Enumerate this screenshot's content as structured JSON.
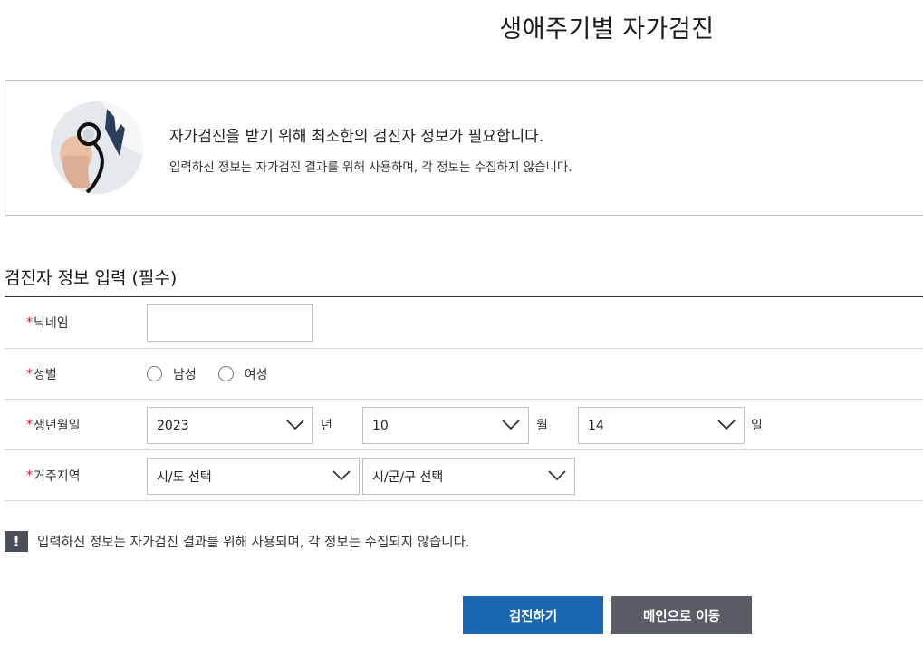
{
  "page": {
    "title": "생애주기별 자가검진"
  },
  "intro": {
    "image_icon": "stethoscope-doctor-photo",
    "main_text": "자가검진을 받기 위해 최소한의 검진자 정보가 필요합니다.",
    "sub_text": "입력하신 정보는 자가검진 결과를 위해 사용하며, 각 정보는 수집하지 않습니다."
  },
  "form": {
    "section_title": "검진자 정보 입력 (필수)",
    "required_mark": "*",
    "nickname": {
      "label": "닉네임",
      "value": "",
      "placeholder": ""
    },
    "gender": {
      "label": "성별",
      "options": [
        "남성",
        "여성"
      ]
    },
    "birthdate": {
      "label": "생년월일",
      "year": "2023",
      "year_unit": "년",
      "month": "10",
      "month_unit": "월",
      "day": "14",
      "day_unit": "일"
    },
    "region": {
      "label": "거주지역",
      "province": "시/도 선택",
      "district": "시/군/구 선택"
    }
  },
  "notice": {
    "icon": "exclamation-icon",
    "icon_glyph": "!",
    "text": "입력하신 정보는 자가검진 결과를 위해 사용되며, 각 정보는 수집되지 않습니다."
  },
  "buttons": {
    "submit": "검진하기",
    "main": "메인으로 이동"
  },
  "colors": {
    "primary": "#1b66b1",
    "secondary": "#595d65",
    "required": "#d32222",
    "notice_icon_bg": "#4a5059"
  }
}
